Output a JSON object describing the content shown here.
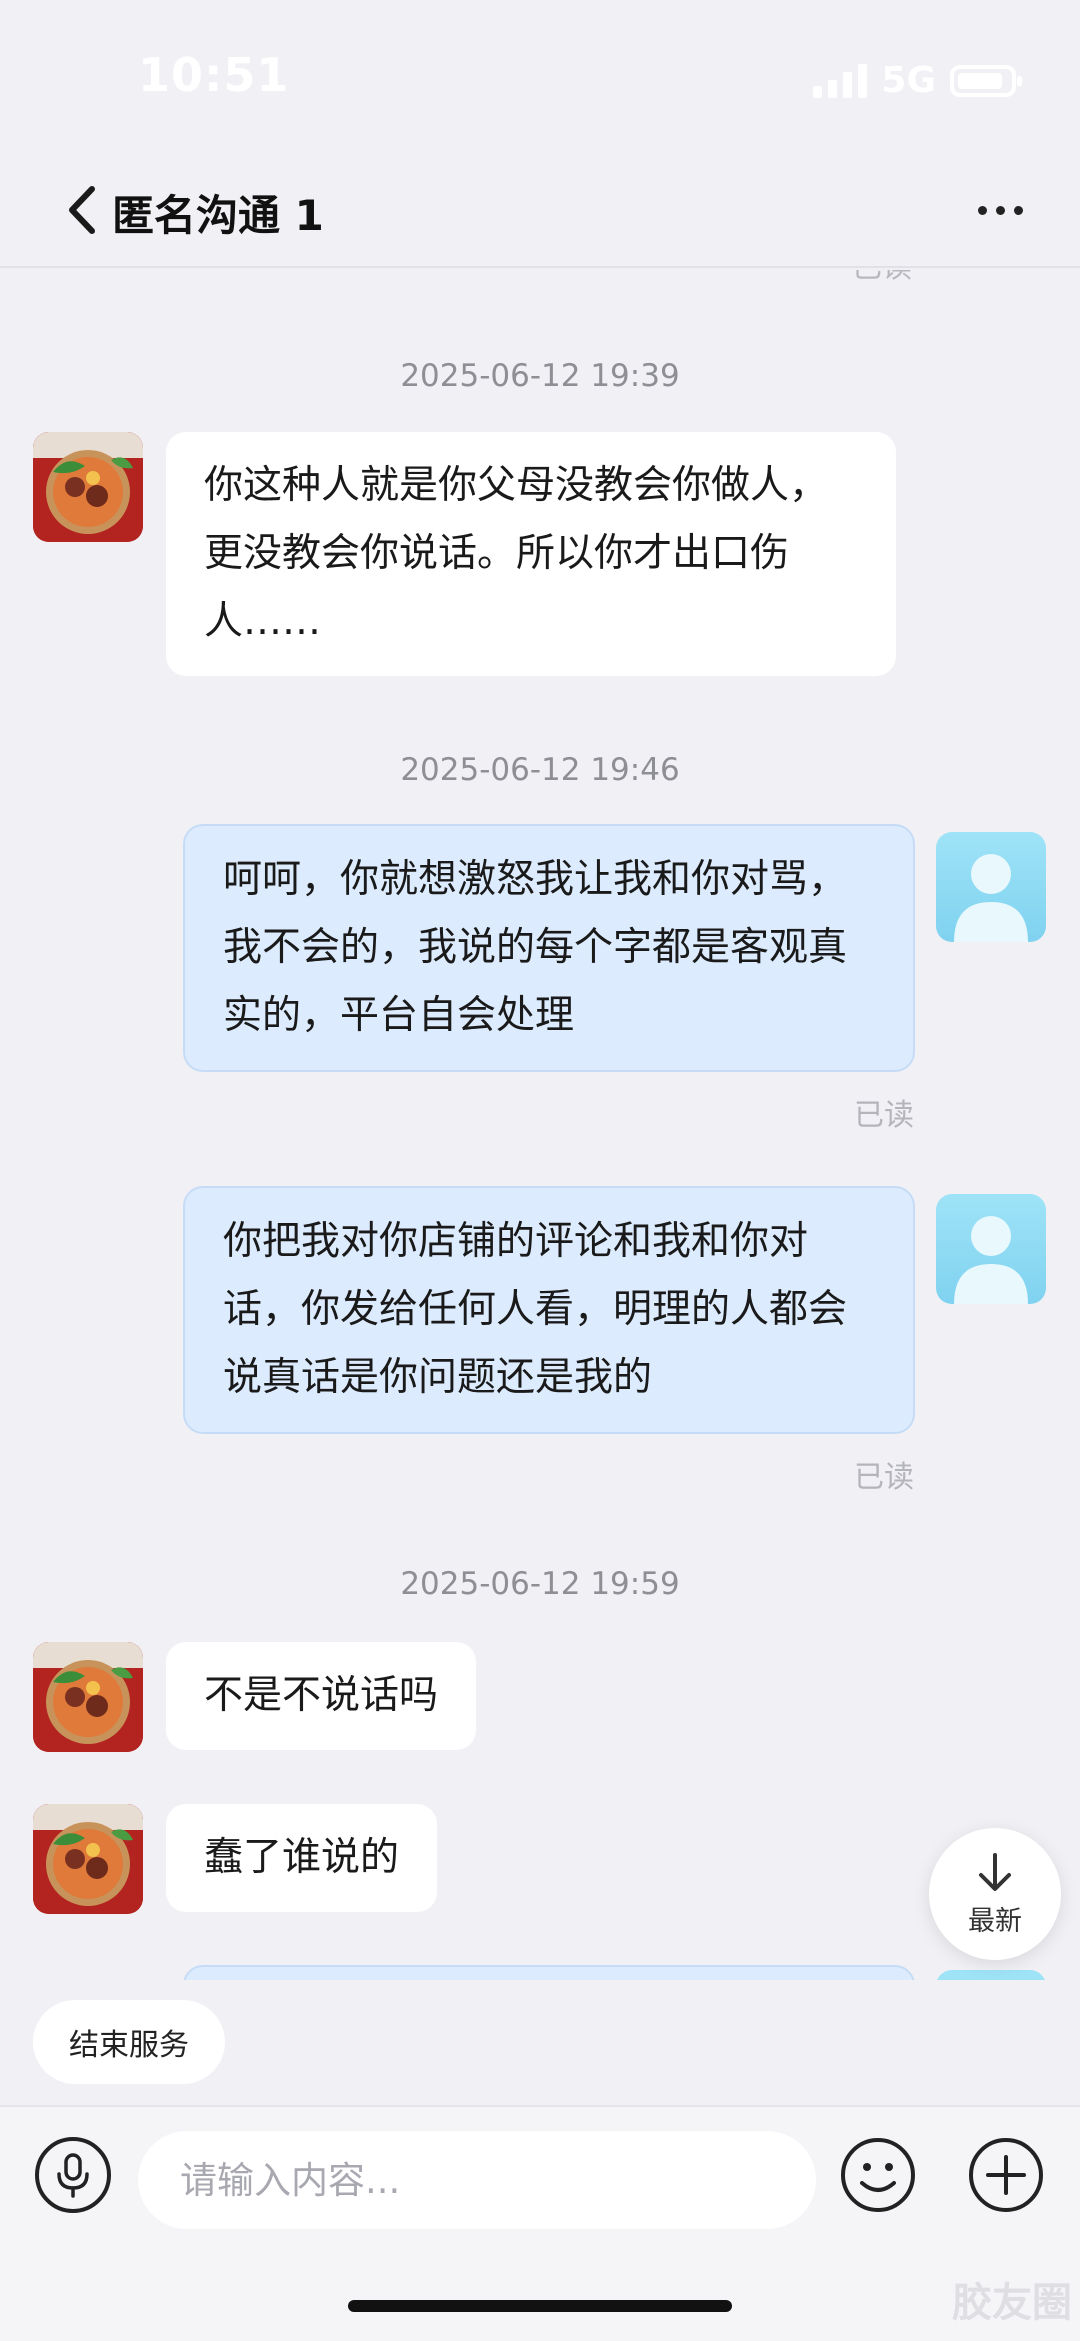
{
  "status_bar": {
    "time": "10:51",
    "network": "5G"
  },
  "header": {
    "title": "匿名沟通 1"
  },
  "messages": {
    "read_label": "已读",
    "groups": [
      {
        "timestamp": "2025-06-12 19:39"
      },
      {
        "timestamp": "2025-06-12 19:46"
      },
      {
        "timestamp": "2025-06-12 19:59"
      }
    ],
    "items": [
      {
        "text": "你这种人就是你父母没教会你做人，更没教会你说话。所以你才出口伤人……"
      },
      {
        "text": "呵呵，你就想激怒我让我和你对骂，我不会的，我说的每个字都是客观真实的，平台自会处理"
      },
      {
        "text": "你把我对你店铺的评论和我和你对话，你发给任何人看，明理的人都会说真话是你问题还是我的"
      },
      {
        "text": "不是不说话吗"
      },
      {
        "text": "蠢了谁说的"
      }
    ]
  },
  "latest_button": {
    "label": "最新"
  },
  "end_service": {
    "label": "结束服务"
  },
  "composer": {
    "placeholder": "请输入内容..."
  },
  "watermark": "胶友圈",
  "icons": {
    "back": "chevron-left-icon",
    "more": "more-dots-icon",
    "voice": "microphone-icon",
    "emoji": "smile-icon",
    "plus": "plus-icon",
    "latest": "arrow-down-icon"
  },
  "colors": {
    "background": "#f1f1f5",
    "outgoing_bubble": "#dcebfd",
    "incoming_bubble": "#ffffff",
    "timestamp": "#8e8e95"
  }
}
